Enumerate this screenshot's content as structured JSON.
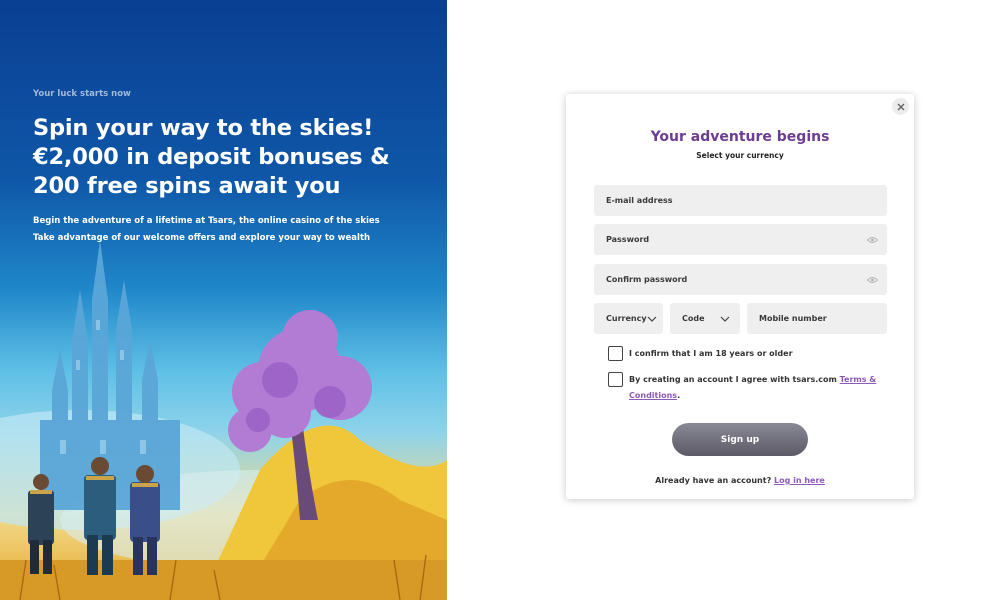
{
  "hero": {
    "eyebrow": "Your luck starts now",
    "title_lines": [
      "Spin your way to the skies!",
      "€2,000 in deposit bonuses &",
      "200 free spins await you"
    ],
    "subtitle_lines": [
      "Begin the adventure of a lifetime at Tsars, the online casino of the skies",
      "Take advantage of our welcome offers and explore your way to wealth"
    ]
  },
  "modal": {
    "title": "Your adventure begins",
    "subtitle": "Select your currency",
    "close_icon": "close-icon",
    "fields": {
      "email_placeholder": "E-mail address",
      "password_placeholder": "Password",
      "confirm_password_placeholder": "Confirm password",
      "currency_label": "Currency",
      "code_label": "Code",
      "mobile_placeholder": "Mobile number"
    },
    "age_check_label": "I confirm that I am 18 years or older",
    "terms_check": {
      "prefix": "By creating an account I agree with tsars.com ",
      "link": "Terms & Conditions",
      "suffix": "."
    },
    "signup_label": "Sign up",
    "login_prompt": "Already have an account?",
    "login_link": "Log in here"
  },
  "colors": {
    "accent_purple": "#6d3d91",
    "link_purple": "#8e5ab8",
    "hero_blue": "#0a3f93",
    "button_gray": "#6c6b76"
  }
}
